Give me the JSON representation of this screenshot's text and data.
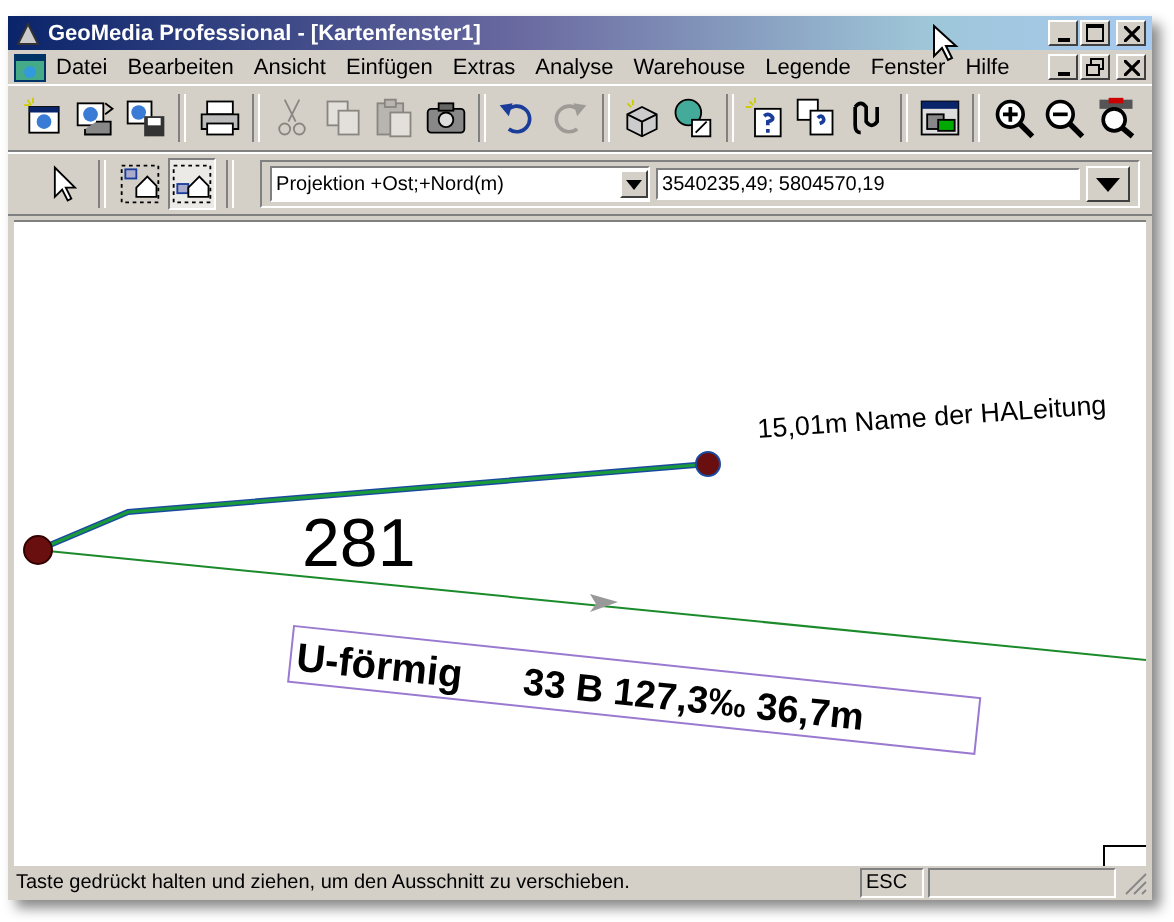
{
  "window": {
    "title": "GeoMedia Professional - [Kartenfenster1]"
  },
  "menu": [
    "Datei",
    "Bearbeiten",
    "Ansicht",
    "Einfügen",
    "Extras",
    "Analyse",
    "Warehouse",
    "Legende",
    "Fenster",
    "Hilfe"
  ],
  "toolbar": [
    {
      "disabled": false
    },
    {
      "disabled": false
    },
    {
      "disabled": false
    },
    {
      "disabled": false
    },
    {
      "disabled": true
    },
    {
      "disabled": true
    },
    {
      "disabled": true
    },
    {
      "disabled": false
    },
    {
      "disabled": false
    },
    {
      "disabled": true
    },
    {
      "disabled": false
    },
    {
      "disabled": false
    },
    {
      "disabled": false
    },
    {
      "disabled": false
    },
    {
      "disabled": false
    },
    {
      "disabled": false
    },
    {
      "disabled": false
    },
    {
      "disabled": false
    },
    {
      "disabled": false
    }
  ],
  "select_tools": [
    {
      "selected": false
    },
    {
      "selected": false
    },
    {
      "selected": true
    }
  ],
  "projection": {
    "value": "Projektion +Ost;+Nord(m)"
  },
  "coordinates": {
    "value": "3540235,49; 5804570,19"
  },
  "map": {
    "labels": [
      {
        "kind": "annotation",
        "text": "15,01m Name der HALeitung"
      },
      {
        "kind": "number",
        "text": "281"
      },
      {
        "kind": "boxed",
        "text": "U-förmig",
        "text_2": "33 B 127,3‰ 36,7m"
      }
    ]
  },
  "status_bar": {
    "message": "Taste gedrückt halten und ziehen, um den Ausschnitt zu verschieben.",
    "key": "ESC"
  }
}
